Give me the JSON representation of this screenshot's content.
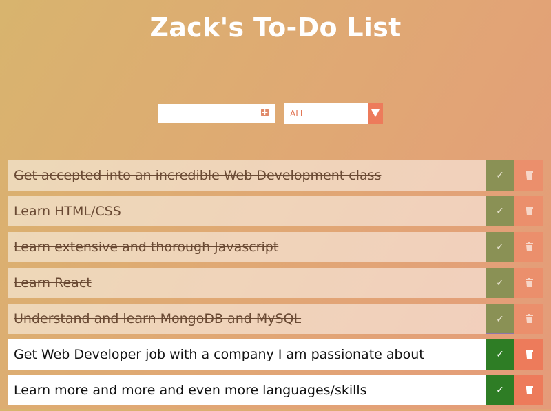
{
  "header": {
    "title": "Zack's To-Do List"
  },
  "form": {
    "input_value": "",
    "add_icon": "plus-square-icon",
    "filter_selected": "ALL",
    "filter_arrow_icon": "triangle-down-icon"
  },
  "todos": [
    {
      "text": "Get accepted into an incredible Web Development class",
      "completed": true
    },
    {
      "text": "Learn HTML/CSS",
      "completed": true
    },
    {
      "text": "Learn extensive and thorough Javascript",
      "completed": true
    },
    {
      "text": "Learn React",
      "completed": true
    },
    {
      "text": "Understand and learn MongoDB and MySQL",
      "completed": true
    },
    {
      "text": "Get Web Developer job with a company I am passionate about",
      "completed": false
    },
    {
      "text": "Learn more and more and even more languages/skills",
      "completed": false
    }
  ],
  "icons": {
    "check": "check-icon",
    "trash": "trash-icon"
  },
  "colors": {
    "check_active": "#2e7d25",
    "trash_active": "#ed7b5b",
    "accent": "#e0704e"
  }
}
